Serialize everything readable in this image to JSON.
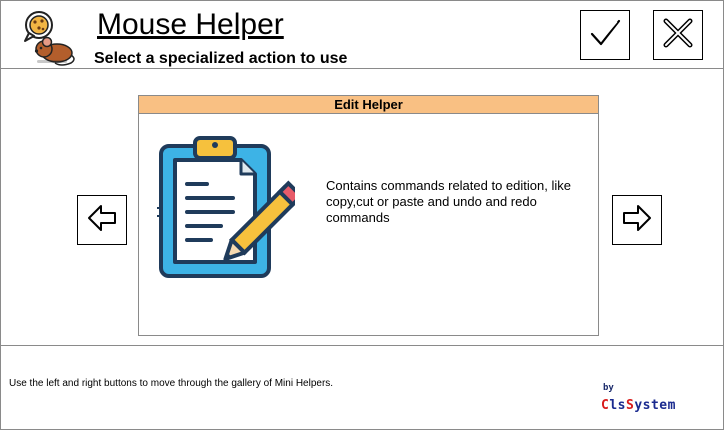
{
  "app": {
    "title": "Mouse Helper",
    "subtitle": "Select a specialized action to use",
    "logo_icon": "mouse-with-cookie-icon"
  },
  "header_buttons": {
    "ok_icon": "checkmark-icon",
    "close_icon": "x-icon"
  },
  "card": {
    "title": "Edit Helper",
    "description": "Contains commands related to edition, like copy,cut or paste and undo and redo commands",
    "icon": "clipboard-pencil-icon",
    "header_color": "#f9c083"
  },
  "navigation": {
    "prev_icon": "arrow-left-icon",
    "next_icon": "arrow-right-icon"
  },
  "footer": {
    "hint": "Use the left and right buttons to move through the gallery of Mini Helpers.",
    "brand_by": "by",
    "brand_name_parts": [
      {
        "text": "C",
        "color": "#d81b1b"
      },
      {
        "text": "ls",
        "color": "#1a2a8f"
      },
      {
        "text": "S",
        "color": "#d81b1b"
      },
      {
        "text": "ystem",
        "color": "#1a2a8f"
      }
    ]
  }
}
